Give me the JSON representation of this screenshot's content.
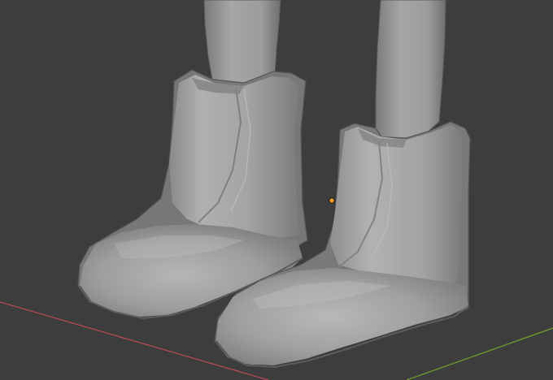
{
  "viewport": {
    "background": "#3d3d3d",
    "mesh_color": "#9a9a9a",
    "origin_color": "#f0a020",
    "axis_x_color": "#b04a55",
    "axis_y_color": "#6f9a2c"
  }
}
